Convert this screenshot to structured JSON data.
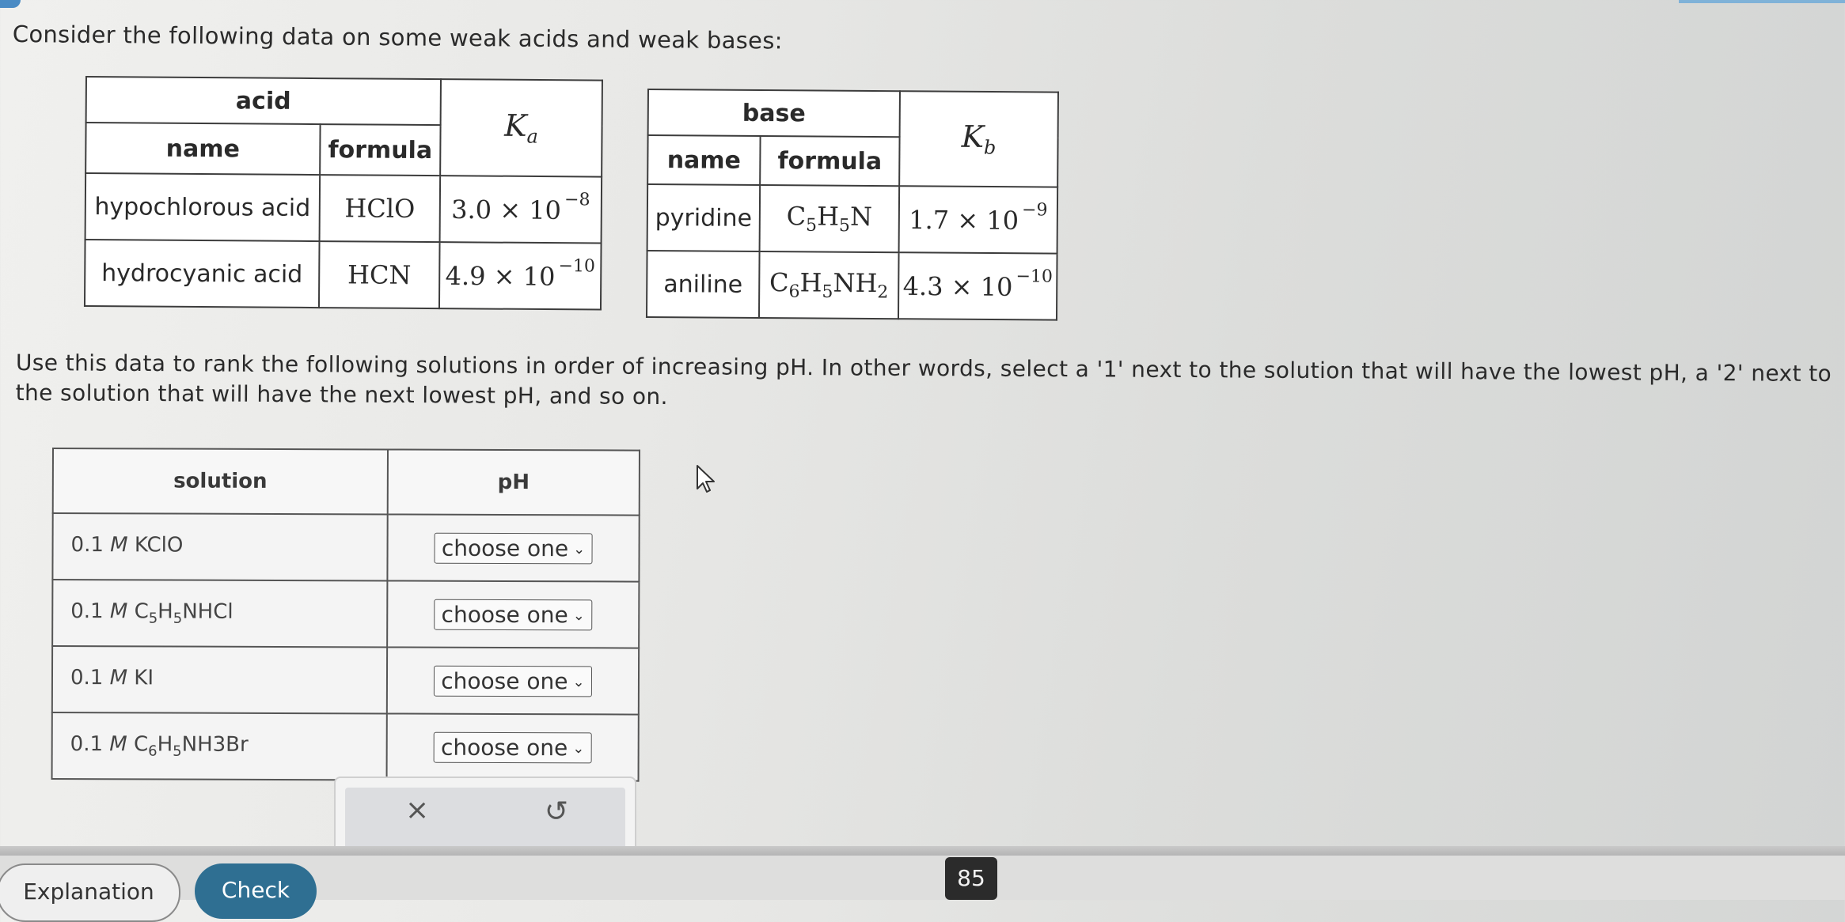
{
  "prompt": {
    "intro": "Consider the following data on some weak acids and weak bases:",
    "instructions": "Use this data to rank the following solutions in order of increasing pH. In other words, select a '1' next to the solution that will have the lowest pH, a '2' next to the solution that will have the next lowest pH, and so on."
  },
  "acid_table": {
    "group_header": "acid",
    "name_header": "name",
    "formula_header": "formula",
    "k_symbol": "K",
    "k_subscript": "a",
    "rows": [
      {
        "name": "hypochlorous acid",
        "formula": "HClO",
        "mantissa": "3.0",
        "times": "×",
        "base10": "10",
        "exponent": "−8"
      },
      {
        "name": "hydrocyanic acid",
        "formula": "HCN",
        "mantissa": "4.9",
        "times": "×",
        "base10": "10",
        "exponent": "−10"
      }
    ]
  },
  "base_table": {
    "group_header": "base",
    "name_header": "name",
    "formula_header": "formula",
    "k_symbol": "K",
    "k_subscript": "b",
    "rows": [
      {
        "name": "pyridine",
        "formula_parts": [
          "C",
          "5",
          "H",
          "5",
          "N",
          ""
        ],
        "mantissa": "1.7",
        "times": "×",
        "base10": "10",
        "exponent": "−9"
      },
      {
        "name": "aniline",
        "formula_parts": [
          "C",
          "6",
          "H",
          "5",
          "NH",
          "2"
        ],
        "mantissa": "4.3",
        "times": "×",
        "base10": "10",
        "exponent": "−10"
      }
    ]
  },
  "rank_table": {
    "solution_header": "solution",
    "ph_header": "pH",
    "select_placeholder": "choose one",
    "rows": [
      {
        "conc": "0.1",
        "unit": "M",
        "parts": [
          "KClO",
          "",
          "",
          "",
          ""
        ]
      },
      {
        "conc": "0.1",
        "unit": "M",
        "parts": [
          "C",
          "5",
          "H",
          "5",
          "NHCl"
        ]
      },
      {
        "conc": "0.1",
        "unit": "M",
        "parts": [
          "KI",
          "",
          "",
          "",
          ""
        ]
      },
      {
        "conc": "0.1",
        "unit": "M",
        "parts": [
          "C",
          "6",
          "H",
          "5",
          "NH3Br"
        ]
      }
    ]
  },
  "actions": {
    "clear_icon": "×",
    "undo_icon": "↺"
  },
  "footer": {
    "explanation_label": "Explanation",
    "check_label": "Check",
    "page_number": "85"
  },
  "icons": {
    "clear": "close-icon",
    "undo": "undo-icon",
    "dropdown": "chevron-down-icon",
    "cursor": "mouse-pointer-icon"
  },
  "colors": {
    "check_button": "#2f6f92",
    "page_badge": "#2b2b2b",
    "accent": "#4a8bc4"
  }
}
